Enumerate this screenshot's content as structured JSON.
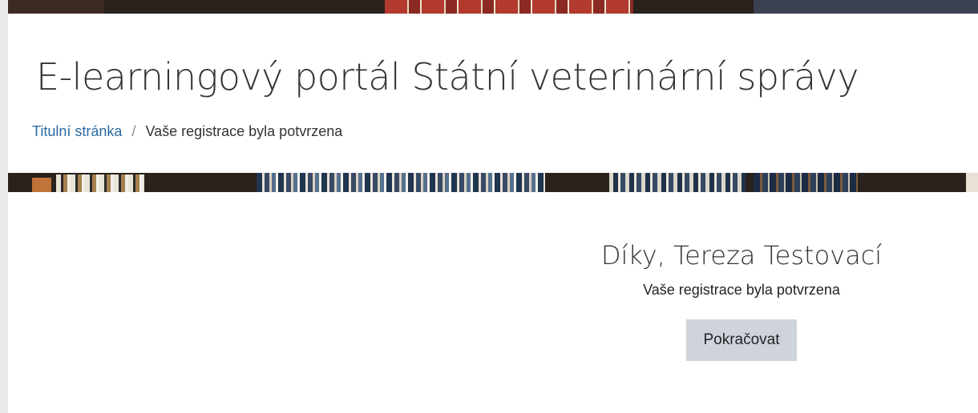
{
  "header": {
    "site_title": "E-learningový portál Státní veterinární správy"
  },
  "breadcrumb": {
    "home": "Titulní stránka",
    "separator": "/",
    "current": "Vaše registrace byla potvrzena"
  },
  "confirmation": {
    "thanks": "Díky, Tereza Testovací",
    "message": "Vaše registrace byla potvrzena",
    "continue_label": "Pokračovat"
  },
  "colors": {
    "link": "#2d6aa0",
    "button_bg": "#ced4da",
    "shelf": "#2a221d"
  }
}
